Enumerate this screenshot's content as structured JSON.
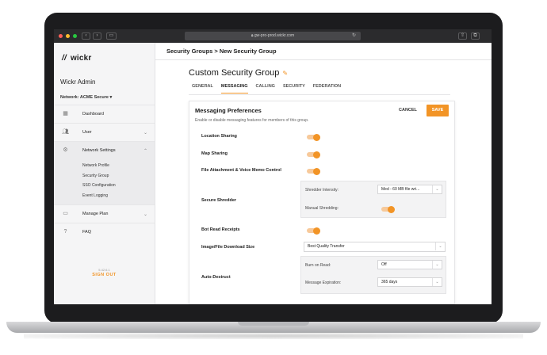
{
  "browser": {
    "url": "gw-pro-prod.wickr.com",
    "back_label": "‹",
    "forward_label": "›",
    "reload_icon": "↻"
  },
  "sidebar": {
    "logo_text": "wickr",
    "logo_mark": "//",
    "admin_title": "Wickr Admin",
    "network_label": "Network: ACME Secure ▾",
    "items": [
      {
        "label": "Dashboard",
        "icon": "dashboard-icon"
      },
      {
        "label": "User",
        "icon": "users-icon"
      },
      {
        "label": "Network Settings",
        "icon": "gear-icon"
      },
      {
        "label": "Manage Plan",
        "icon": "card-icon"
      },
      {
        "label": "FAQ",
        "icon": "help-icon"
      }
    ],
    "sub_items": [
      "Network Profile",
      "Security Group",
      "SSO Configuration",
      "Event Logging"
    ],
    "version": "5.42.6.1",
    "signout": "SIGN OUT"
  },
  "topbar": {
    "breadcrumb": "Security Groups > New Security Group"
  },
  "main": {
    "title": "Custom Security Group",
    "tabs": [
      "GENERAL",
      "MESSAGING",
      "CALLING",
      "SECURITY",
      "FEDERATION"
    ],
    "active_tab": "MESSAGING"
  },
  "panel": {
    "title": "Messaging Preferences",
    "subtitle": "Enable or disable messaging features for members of this group.",
    "cancel_label": "CANCEL",
    "save_label": "SAVE",
    "rows": {
      "location_sharing": {
        "label": "Location Sharing",
        "enabled": true
      },
      "map_sharing": {
        "label": "Map Sharing",
        "enabled": true
      },
      "file_attachment": {
        "label": "File Attachment & Voice Memo Control",
        "enabled": true
      },
      "secure_shredder": {
        "label": "Secure Shredder",
        "intensity_label": "Shredder Intensity:",
        "intensity_value": "Med - 60 MB file wri...",
        "manual_label": "Manual Shredding:",
        "manual_enabled": true
      },
      "bot_read_receipts": {
        "label": "Bot Read Receipts",
        "enabled": true
      },
      "download_size": {
        "label": "Image/File Download Size",
        "value": "Best Quality Transfer"
      },
      "auto_destruct": {
        "label": "Auto-Destruct",
        "burn_label": "Burn on Read:",
        "burn_value": "Off",
        "expiration_label": "Message Expiration:",
        "expiration_value": "365 days"
      }
    }
  },
  "colors": {
    "accent": "#f29426",
    "toggle_track": "#f7c99a"
  }
}
